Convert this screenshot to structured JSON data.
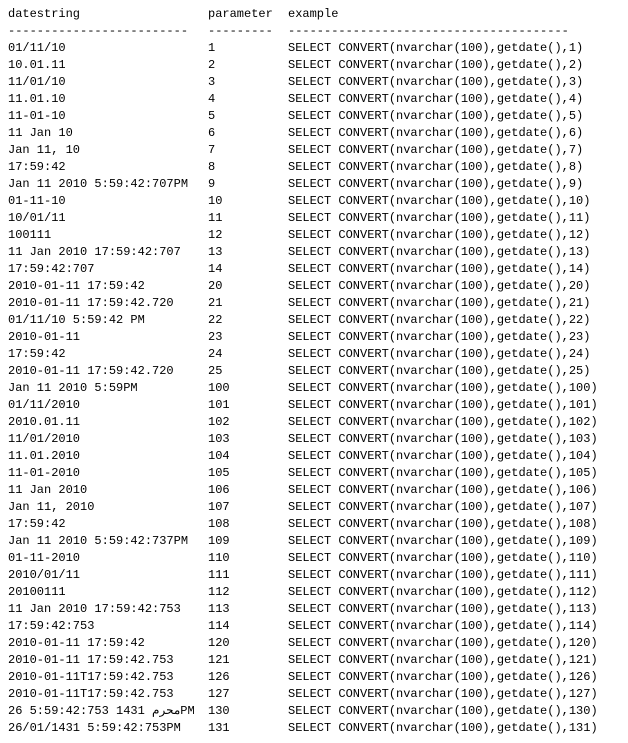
{
  "headers": {
    "c1": "datestring",
    "c2": "parameter",
    "c3": "example"
  },
  "dividers": {
    "c1": "-------------------------",
    "c2": "---------",
    "c3": "---------------------------------------"
  },
  "rows": [
    {
      "ds": "01/11/10",
      "p": "1",
      "ex": "SELECT CONVERT(nvarchar(100),getdate(),1)"
    },
    {
      "ds": "10.01.11",
      "p": "2",
      "ex": "SELECT CONVERT(nvarchar(100),getdate(),2)"
    },
    {
      "ds": "11/01/10",
      "p": "3",
      "ex": "SELECT CONVERT(nvarchar(100),getdate(),3)"
    },
    {
      "ds": "11.01.10",
      "p": "4",
      "ex": "SELECT CONVERT(nvarchar(100),getdate(),4)"
    },
    {
      "ds": "11-01-10",
      "p": "5",
      "ex": "SELECT CONVERT(nvarchar(100),getdate(),5)"
    },
    {
      "ds": "11 Jan 10",
      "p": "6",
      "ex": "SELECT CONVERT(nvarchar(100),getdate(),6)"
    },
    {
      "ds": "Jan 11, 10",
      "p": "7",
      "ex": "SELECT CONVERT(nvarchar(100),getdate(),7)"
    },
    {
      "ds": "17:59:42",
      "p": "8",
      "ex": "SELECT CONVERT(nvarchar(100),getdate(),8)"
    },
    {
      "ds": "Jan 11 2010  5:59:42:707PM",
      "p": "9",
      "ex": "SELECT CONVERT(nvarchar(100),getdate(),9)"
    },
    {
      "ds": "01-11-10",
      "p": "10",
      "ex": "SELECT CONVERT(nvarchar(100),getdate(),10)"
    },
    {
      "ds": "10/01/11",
      "p": "11",
      "ex": "SELECT CONVERT(nvarchar(100),getdate(),11)"
    },
    {
      "ds": "100111",
      "p": "12",
      "ex": "SELECT CONVERT(nvarchar(100),getdate(),12)"
    },
    {
      "ds": "11 Jan 2010 17:59:42:707",
      "p": "13",
      "ex": "SELECT CONVERT(nvarchar(100),getdate(),13)"
    },
    {
      "ds": "17:59:42:707",
      "p": "14",
      "ex": "SELECT CONVERT(nvarchar(100),getdate(),14)"
    },
    {
      "ds": "2010-01-11 17:59:42",
      "p": "20",
      "ex": "SELECT CONVERT(nvarchar(100),getdate(),20)"
    },
    {
      "ds": "2010-01-11 17:59:42.720",
      "p": "21",
      "ex": "SELECT CONVERT(nvarchar(100),getdate(),21)"
    },
    {
      "ds": "01/11/10  5:59:42 PM",
      "p": "22",
      "ex": "SELECT CONVERT(nvarchar(100),getdate(),22)"
    },
    {
      "ds": "2010-01-11",
      "p": "23",
      "ex": "SELECT CONVERT(nvarchar(100),getdate(),23)"
    },
    {
      "ds": "17:59:42",
      "p": "24",
      "ex": "SELECT CONVERT(nvarchar(100),getdate(),24)"
    },
    {
      "ds": "2010-01-11 17:59:42.720",
      "p": "25",
      "ex": "SELECT CONVERT(nvarchar(100),getdate(),25)"
    },
    {
      "ds": "Jan 11 2010  5:59PM",
      "p": "100",
      "ex": "SELECT CONVERT(nvarchar(100),getdate(),100)"
    },
    {
      "ds": "01/11/2010",
      "p": "101",
      "ex": "SELECT CONVERT(nvarchar(100),getdate(),101)"
    },
    {
      "ds": "2010.01.11",
      "p": "102",
      "ex": "SELECT CONVERT(nvarchar(100),getdate(),102)"
    },
    {
      "ds": "11/01/2010",
      "p": "103",
      "ex": "SELECT CONVERT(nvarchar(100),getdate(),103)"
    },
    {
      "ds": "11.01.2010",
      "p": "104",
      "ex": "SELECT CONVERT(nvarchar(100),getdate(),104)"
    },
    {
      "ds": "11-01-2010",
      "p": "105",
      "ex": "SELECT CONVERT(nvarchar(100),getdate(),105)"
    },
    {
      "ds": "11 Jan 2010",
      "p": "106",
      "ex": "SELECT CONVERT(nvarchar(100),getdate(),106)"
    },
    {
      "ds": "Jan 11, 2010",
      "p": "107",
      "ex": "SELECT CONVERT(nvarchar(100),getdate(),107)"
    },
    {
      "ds": "17:59:42",
      "p": "108",
      "ex": "SELECT CONVERT(nvarchar(100),getdate(),108)"
    },
    {
      "ds": "Jan 11 2010  5:59:42:737PM",
      "p": "109",
      "ex": "SELECT CONVERT(nvarchar(100),getdate(),109)"
    },
    {
      "ds": "01-11-2010",
      "p": "110",
      "ex": "SELECT CONVERT(nvarchar(100),getdate(),110)"
    },
    {
      "ds": "2010/01/11",
      "p": "111",
      "ex": "SELECT CONVERT(nvarchar(100),getdate(),111)"
    },
    {
      "ds": "20100111",
      "p": "112",
      "ex": "SELECT CONVERT(nvarchar(100),getdate(),112)"
    },
    {
      "ds": "11 Jan 2010 17:59:42:753",
      "p": "113",
      "ex": "SELECT CONVERT(nvarchar(100),getdate(),113)"
    },
    {
      "ds": "17:59:42:753",
      "p": "114",
      "ex": "SELECT CONVERT(nvarchar(100),getdate(),114)"
    },
    {
      "ds": "2010-01-11 17:59:42",
      "p": "120",
      "ex": "SELECT CONVERT(nvarchar(100),getdate(),120)"
    },
    {
      "ds": "2010-01-11 17:59:42.753",
      "p": "121",
      "ex": "SELECT CONVERT(nvarchar(100),getdate(),121)"
    },
    {
      "ds": "2010-01-11T17:59:42.753",
      "p": "126",
      "ex": "SELECT CONVERT(nvarchar(100),getdate(),126)"
    },
    {
      "ds": "2010-01-11T17:59:42.753",
      "p": "127",
      "ex": "SELECT CONVERT(nvarchar(100),getdate(),127)"
    },
    {
      "ds": "26 5:59:42:753 محرم 1431PM",
      "p": "130",
      "ex": " SELECT CONVERT(nvarchar(100),getdate(),130)"
    },
    {
      "ds": "26/01/1431  5:59:42:753PM",
      "p": "131",
      "ex": "SELECT CONVERT(nvarchar(100),getdate(),131)"
    }
  ]
}
